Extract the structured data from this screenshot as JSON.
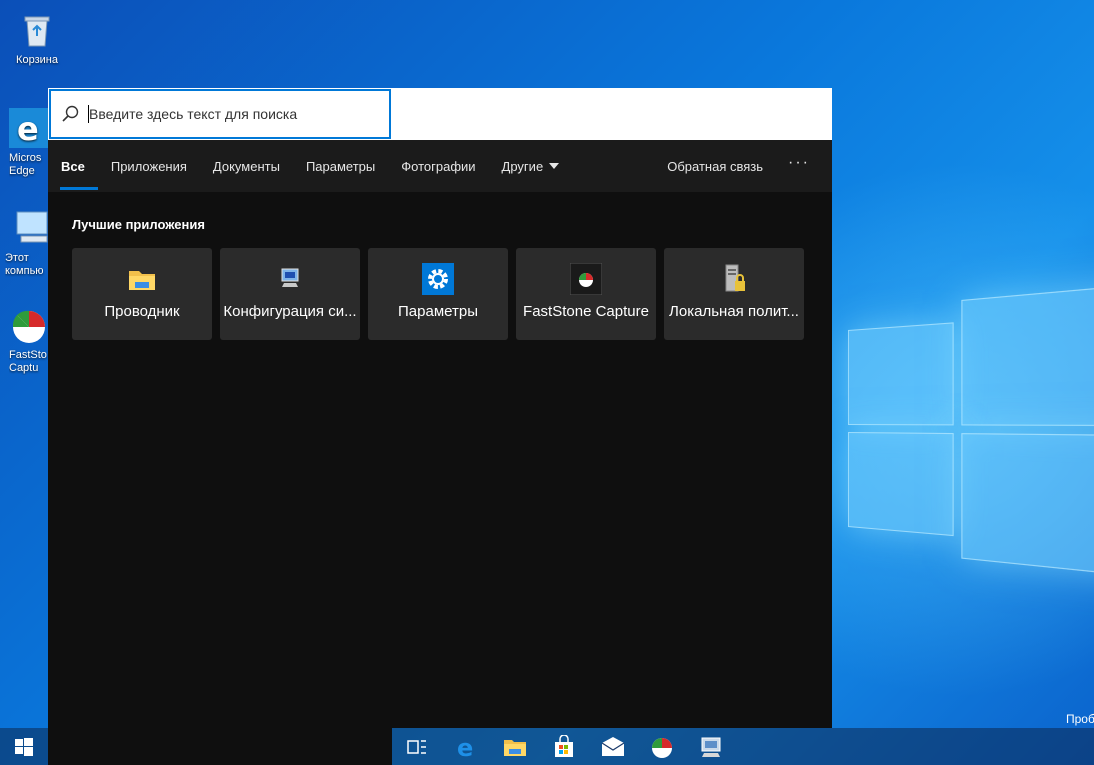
{
  "desktop": {
    "icons": [
      {
        "label": "Корзина"
      },
      {
        "label": "Micros Edge"
      },
      {
        "label": "Этот компью"
      },
      {
        "label": "FastSto Captu"
      }
    ],
    "corner_text": "Проб"
  },
  "search": {
    "placeholder": "Введите здесь текст для поиска"
  },
  "tabs": {
    "all": "Все",
    "apps": "Приложения",
    "documents": "Документы",
    "settings": "Параметры",
    "photos": "Фотографии",
    "other": "Другие",
    "feedback": "Обратная связь",
    "more": "···"
  },
  "best_apps": {
    "title": "Лучшие приложения",
    "items": [
      {
        "label": "Проводник",
        "icon": "folder-icon"
      },
      {
        "label": "Конфигурация си...",
        "icon": "system-config-icon"
      },
      {
        "label": "Параметры",
        "icon": "gear-icon"
      },
      {
        "label": "FastStone Capture",
        "icon": "faststone-icon"
      },
      {
        "label": "Локальная полит...",
        "icon": "local-policy-icon"
      }
    ]
  },
  "colors": {
    "accent": "#0078d7",
    "panel": "#0f0f0f",
    "tile": "#2b2b2b"
  }
}
